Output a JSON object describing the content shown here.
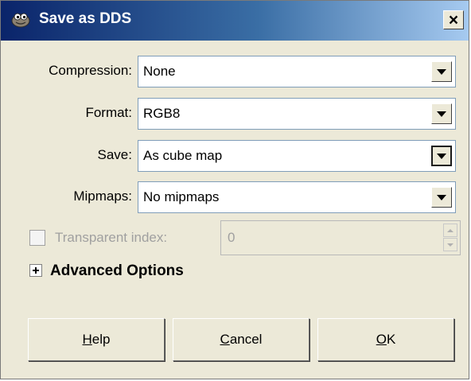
{
  "window": {
    "title": "Save as DDS",
    "close_glyph": "×",
    "icon": "gimp-icon"
  },
  "form": {
    "compression": {
      "label": "Compression:",
      "value": "None"
    },
    "format": {
      "label": "Format:",
      "value": "RGB8"
    },
    "save": {
      "label": "Save:",
      "value": "As cube map"
    },
    "mipmaps": {
      "label": "Mipmaps:",
      "value": "No mipmaps"
    },
    "transparent_index": {
      "label": "Transparent index:",
      "value": "0",
      "checked": false,
      "enabled": false
    }
  },
  "advanced": {
    "label": "Advanced Options",
    "expanded": false
  },
  "buttons": {
    "help": {
      "mnemonic": "H",
      "rest": "elp"
    },
    "cancel": {
      "mnemonic": "C",
      "rest": "ancel"
    },
    "ok": {
      "mnemonic": "O",
      "rest": "K"
    }
  },
  "colors": {
    "titlebar_start": "#0a246a",
    "titlebar_end": "#a6caf0",
    "face": "#ece9d8"
  }
}
